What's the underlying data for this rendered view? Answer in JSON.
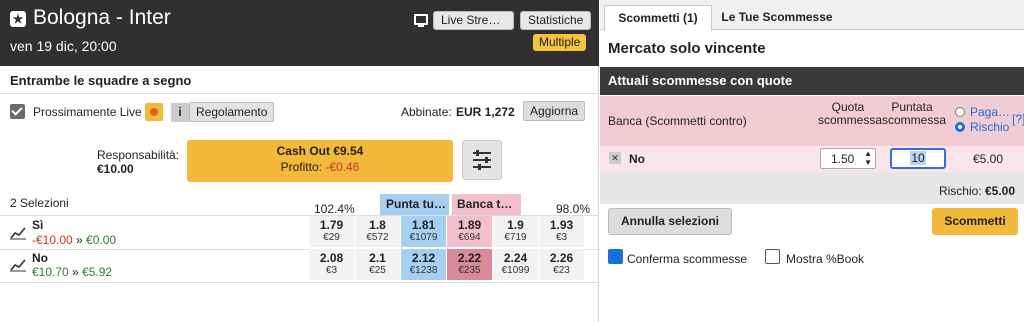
{
  "event": {
    "title": "Bologna - Inter",
    "date": "ven 19 dic, 20:00"
  },
  "header": {
    "live_stream": "Live Stre…",
    "stats": "Statistiche",
    "multiple": "Multiple"
  },
  "market": {
    "name": "Entrambe le squadre a segno",
    "prossimamente_live": "Prossimamente Live",
    "regolamento": "Regolamento",
    "info": "i",
    "abbinate_label": "Abbinate:",
    "abbinate_value": "EUR 1,272",
    "aggiorna": "Aggiorna",
    "resp_label": "Responsabilità:",
    "resp_value": "€10.00",
    "cashout_label": "Cash Out €9.54",
    "profit_label": "Profitto:",
    "profit_value": "-€0.46",
    "selections": "2 Selezioni",
    "back_pct": "102.4%",
    "lay_pct": "98.0%",
    "back_all": "Punta tu…",
    "lay_all": "Banca t…",
    "runners": [
      {
        "name": "Sì",
        "pl_a": "-€10.00",
        "arrow": "»",
        "pl_b": "€0.00",
        "odds": [
          [
            "1.79",
            "€29"
          ],
          [
            "1.8",
            "€572"
          ],
          [
            "1.81",
            "€1079"
          ],
          [
            "1.89",
            "€694"
          ],
          [
            "1.9",
            "€719"
          ],
          [
            "1.93",
            "€3"
          ]
        ]
      },
      {
        "name": "No",
        "pl_a": "€10.70",
        "arrow": "»",
        "pl_b": "€5.92",
        "odds": [
          [
            "2.08",
            "€3"
          ],
          [
            "2.1",
            "€25"
          ],
          [
            "2.12",
            "€1238"
          ],
          [
            "2.22",
            "€235"
          ],
          [
            "2.24",
            "€1099"
          ],
          [
            "2.26",
            "€23"
          ]
        ]
      }
    ]
  },
  "slip": {
    "tab1": "Scommetti (1)",
    "tab2": "Le Tue Scommesse",
    "market_title": "Mercato solo vincente",
    "section": "Attuali scommesse con quote",
    "col_banca": "Banca (Scommetti contro)",
    "col_quota": "Quota scommessa",
    "col_puntata": "Puntata scommessa",
    "radio_paga": "Paga…",
    "radio_rischio": "Rischio",
    "help": "[?]",
    "bet_x": "✕",
    "bet_name": "No",
    "bet_odds": "1.50",
    "bet_stake": "10",
    "bet_liability": "€5.00",
    "rischio_total": "Rischio: €5.00",
    "annulla": "Annulla selezioni",
    "scommetti": "Scommetti",
    "conferma": "Conferma scommesse",
    "mostra": "Mostra %Book"
  }
}
